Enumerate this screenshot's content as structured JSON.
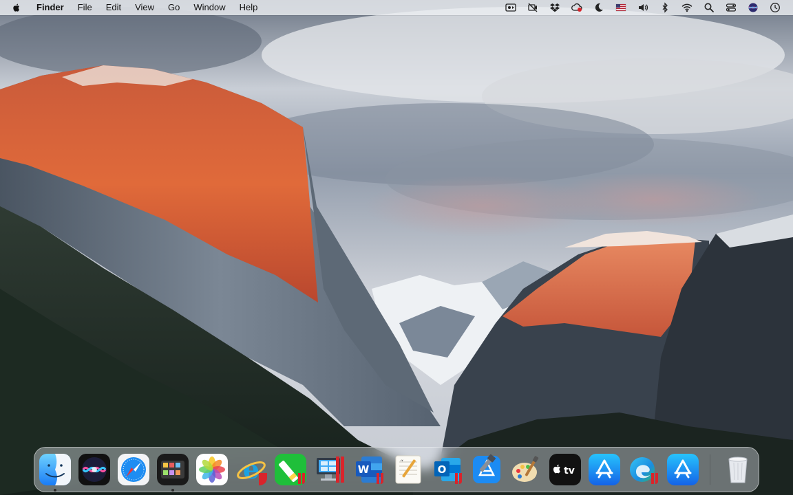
{
  "menubar": {
    "app_name": "Finder",
    "items": [
      "File",
      "Edit",
      "View",
      "Go",
      "Window",
      "Help"
    ],
    "status_icons": [
      "screen-record-icon",
      "camera-off-icon",
      "dropbox-icon",
      "cloud-sync-icon",
      "moon-icon",
      "us-flag-icon",
      "volume-icon",
      "bluetooth-icon",
      "wifi-icon",
      "search-icon",
      "control-center-icon",
      "siri-icon",
      "clock-icon"
    ]
  },
  "dock": {
    "apps": [
      {
        "name": "Finder",
        "icon": "finder-icon",
        "running": true
      },
      {
        "name": "Siri",
        "icon": "siri-icon",
        "running": false
      },
      {
        "name": "Safari",
        "icon": "safari-icon",
        "running": false
      },
      {
        "name": "Photo Booth",
        "icon": "photo-booth-icon",
        "running": true
      },
      {
        "name": "Photos",
        "icon": "photos-icon",
        "running": false
      },
      {
        "name": "Internet Explorer",
        "icon": "internet-explorer-icon",
        "running": false
      },
      {
        "name": "Notepad++",
        "icon": "notepad-icon",
        "running": false
      },
      {
        "name": "Windows 10",
        "icon": "windows-vm-icon",
        "running": false
      },
      {
        "name": "Microsoft Word",
        "icon": "word-icon",
        "running": false
      },
      {
        "name": "TextEdit",
        "icon": "textedit-icon",
        "running": false
      },
      {
        "name": "Microsoft Outlook",
        "icon": "outlook-icon",
        "running": false
      },
      {
        "name": "Xcode",
        "icon": "xcode-icon",
        "running": false
      },
      {
        "name": "Paint",
        "icon": "paint-icon",
        "running": false
      },
      {
        "name": "Apple TV",
        "icon": "apple-tv-icon",
        "label": "tv",
        "running": false
      },
      {
        "name": "App Store",
        "icon": "app-store-icon",
        "running": false
      },
      {
        "name": "Microsoft Edge",
        "icon": "edge-icon",
        "running": false
      },
      {
        "name": "App Store",
        "icon": "app-store-icon",
        "running": false
      },
      {
        "name": "Trash",
        "icon": "trash-icon",
        "running": false
      }
    ]
  },
  "colors": {
    "menubar_bg": "#eceef2",
    "accent_blue": "#1a7cf5",
    "parallels_red": "#d9242b"
  }
}
